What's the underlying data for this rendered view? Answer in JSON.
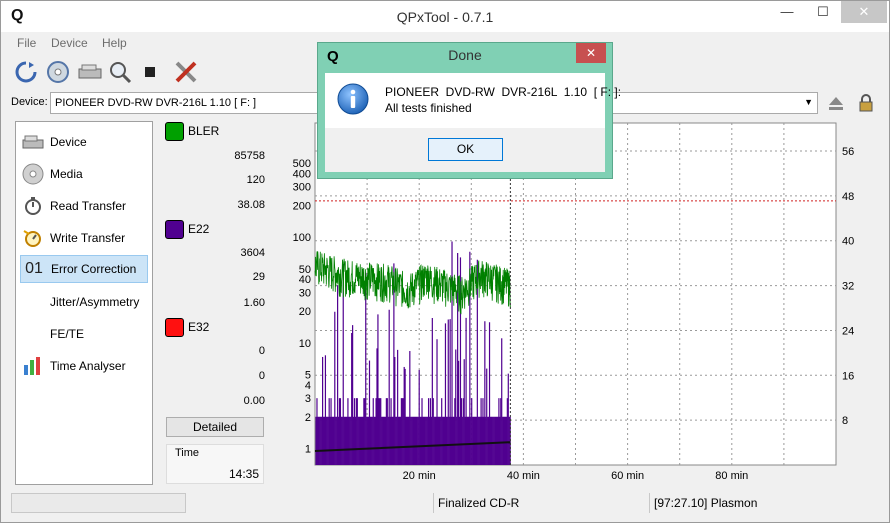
{
  "window": {
    "title": "QPxTool - 0.7.1",
    "icon_letter": "Q",
    "controls": [
      "—",
      "☐",
      "✕"
    ]
  },
  "menu": [
    "File",
    "Device",
    "Help"
  ],
  "toolbar": {
    "icons": [
      "refresh-icon",
      "disc-scan-icon",
      "drive-icon",
      "zoom-icon",
      "stop-icon",
      "tools-icon"
    ]
  },
  "device": {
    "label": "Device:",
    "value": "PIONEER  DVD-RW  DVR-216L  1.10  [ F: ]"
  },
  "sidebar": {
    "items": [
      {
        "label": "Device",
        "icon": "drive-icon"
      },
      {
        "label": "Media",
        "icon": "disc-icon"
      },
      {
        "label": "Read Transfer",
        "icon": "stopwatch-icon"
      },
      {
        "label": "Write Transfer",
        "icon": "stopwatch-write-icon"
      },
      {
        "label": "Error Correction",
        "icon": "01"
      },
      {
        "label": "Jitter/Asymmetry",
        "icon": ""
      },
      {
        "label": "FE/TE",
        "icon": ""
      },
      {
        "label": "Time Analyser",
        "icon": "bar-chart-icon"
      }
    ]
  },
  "stats": {
    "bler": {
      "label": "BLER",
      "color": "#00a000",
      "values": [
        "85758",
        "120",
        "38.08"
      ]
    },
    "e22": {
      "label": "E22",
      "color": "#500090",
      "values": [
        "3604",
        "29",
        "1.60"
      ]
    },
    "e32": {
      "label": "E32",
      "color": "#ff1010",
      "values": [
        "0",
        "0",
        "0.00"
      ]
    },
    "detailed_label": "Detailed",
    "time_label": "Time",
    "time_value": "14:35"
  },
  "chart_data": {
    "type": "line",
    "x_ticks": [
      "20 min",
      "40 min",
      "60 min",
      "80 min"
    ],
    "xlim": [
      0,
      100
    ],
    "y_left_ticks": [
      "1",
      "2",
      "3",
      "4",
      "5",
      "10",
      "20",
      "30",
      "40",
      "50",
      "100",
      "200",
      "300",
      "400",
      "500"
    ],
    "y_left_scale": "log",
    "y_right_ticks": [
      "8",
      "16",
      "24",
      "32",
      "40",
      "48",
      "56"
    ],
    "threshold_red": 220,
    "current_end_min": 37.5,
    "series": [
      {
        "name": "BLER",
        "color": "#00a000"
      },
      {
        "name": "E22",
        "color": "#500090"
      }
    ]
  },
  "status": {
    "left": "",
    "middle": "Finalized CD-R",
    "right": "[97:27.10] Plasmon"
  },
  "dialog": {
    "title": "Done",
    "icon": "info-icon",
    "line1": "PIONEER  DVD-RW  DVR-216L  1.10  [ F: ]:",
    "line2": "All tests finished",
    "ok_label": "OK",
    "close": "✕"
  }
}
